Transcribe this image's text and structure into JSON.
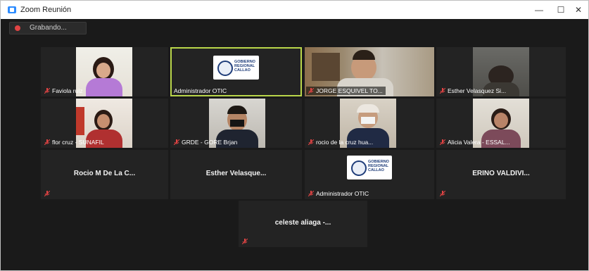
{
  "window": {
    "title": "Zoom Reunión",
    "minimize": "—",
    "maximize": "☐",
    "close": "✕"
  },
  "recording": {
    "label": "Grabando..."
  },
  "colors": {
    "active_speaker": "#b9d64a",
    "muted_mic": "#e14444",
    "recording_dot": "#e14444",
    "tile_bg": "#232323"
  },
  "logo": {
    "text_line1": "GOBIERNO",
    "text_line2": "REGIONAL",
    "text_line3": "CALLAO"
  },
  "participants": [
    {
      "name": "Faviola ruiz",
      "muted": true
    },
    {
      "name": "Administrador OTIC",
      "muted": false,
      "active": true
    },
    {
      "name": "JORGE ESQUIVEL TO...",
      "muted": true
    },
    {
      "name": "Esther Velasquez Si...",
      "muted": true
    },
    {
      "name": "flor cruz - SUNAFIL",
      "muted": true
    },
    {
      "name": "GRDE - GORE Brjan",
      "muted": true
    },
    {
      "name": "rocio de la cruz hua...",
      "muted": true
    },
    {
      "name": "Alicia Valera - ESSAL...",
      "muted": true
    },
    {
      "name": "Rocio M De La C...",
      "muted": true
    },
    {
      "name": "Esther Velasque...",
      "muted": false
    },
    {
      "name": "Administrador OTIC",
      "muted": true
    },
    {
      "name": "ERINO VALDIVI...",
      "muted": true
    },
    {
      "name": "celeste aliaga -...",
      "muted": true
    }
  ]
}
